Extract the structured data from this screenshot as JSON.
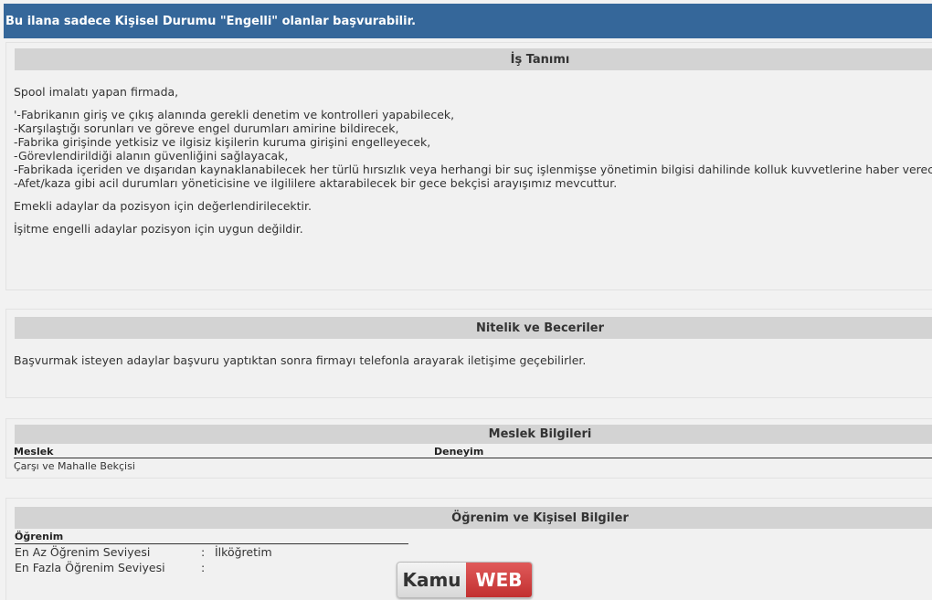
{
  "banner": {
    "text": "Bu ilana sadece Kişisel Durumu \"Engelli\" olanlar başvurabilir."
  },
  "job_description": {
    "title": "İş Tanımı",
    "intro": "Spool imalatı yapan firmada,",
    "duties": [
      "'-Fabrikanın giriş ve çıkış alanında gerekli denetim ve kontrolleri yapabilecek,",
      "-Karşılaştığı sorunları ve göreve engel durumları amirine bildirecek,",
      "-Fabrika girişinde yetkisiz ve ilgisiz kişilerin kuruma girişini engelleyecek,",
      "-Görevlendirildiği alanın güvenliğini sağlayacak,",
      "-Fabrikada içeriden ve dışarıdan kaynaklanabilecek her türlü hırsızlık veya herhangi bir suç işlenmişse yönetimin bilgisi dahilinde kolluk kuvvetlerine haber verecek,",
      "-Afet/kaza gibi acil durumları yöneticisine ve ilgililere aktarabilecek bir gece bekçisi arayışımız mevcuttur."
    ],
    "note1": "Emekli adaylar da pozisyon için değerlendirilecektir.",
    "note2": "İşitme engelli adaylar pozisyon için uygun değildir."
  },
  "qualifications": {
    "title": "Nitelik ve Beceriler",
    "text": "Başvurmak isteyen adaylar başvuru yaptıktan sonra firmayı telefonla arayarak iletişime geçebilirler."
  },
  "occupation": {
    "title": "Meslek Bilgileri",
    "col_job": "Meslek",
    "col_exp": "Deneyim",
    "job": "Çarşı ve Mahalle Bekçisi"
  },
  "education": {
    "title": "Öğrenim ve Kişisel Bilgiler",
    "section": "Öğrenim",
    "min_label": "En Az Öğrenim Seviyesi",
    "min_sep": ":",
    "min_value": "İlköğretim",
    "max_label": "En Fazla Öğrenim Seviyesi",
    "max_sep": ":",
    "max_value": ""
  },
  "logo": {
    "part1": "Kamu",
    "part2": "WEB"
  }
}
